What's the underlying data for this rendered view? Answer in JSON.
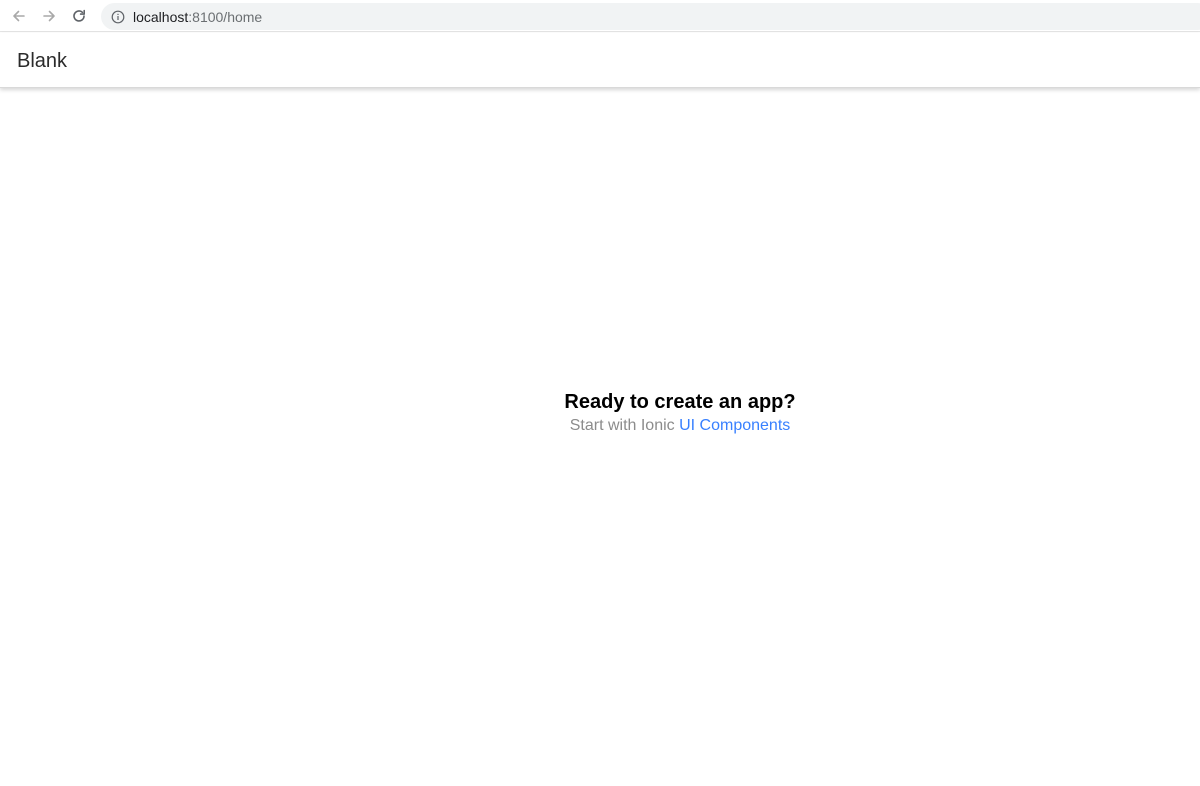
{
  "browser": {
    "url_host": "localhost",
    "url_rest": ":8100/home",
    "icons": {
      "back": "arrow-left-icon",
      "forward": "arrow-right-icon",
      "reload": "reload-icon",
      "info": "info-icon"
    }
  },
  "header": {
    "title": "Blank"
  },
  "main": {
    "headline": "Ready to create an app?",
    "sub_prefix": "Start with Ionic",
    "link_text": "UI Components"
  },
  "colors": {
    "link": "#3880ff",
    "muted": "#8c8c8c",
    "address_bg": "#f1f3f4"
  }
}
